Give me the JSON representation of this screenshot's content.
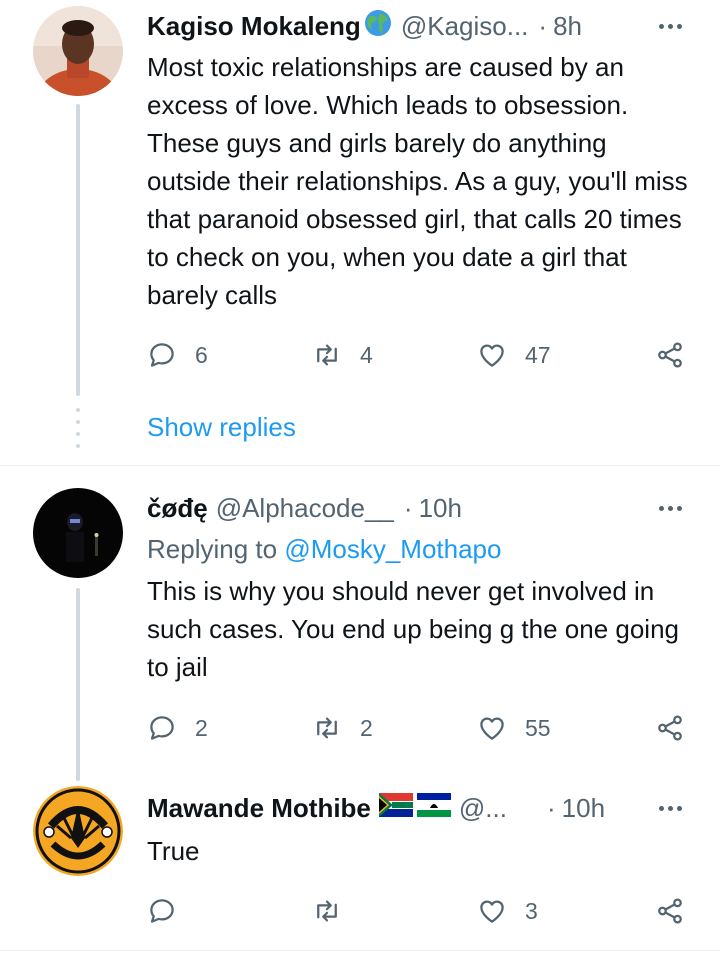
{
  "tweets": [
    {
      "name": "Kagiso Mokaleng",
      "handle": "@Kagiso...",
      "time": "8h",
      "text": "Most toxic relationships are caused by an excess of love. Which leads to obsession. These guys and girls barely do anything outside their relationships. As a guy, you'll miss that paranoid obsessed girl, that calls 20 times to check on you, when you date a girl that barely calls",
      "replies": "6",
      "retweets": "4",
      "likes": "47"
    },
    {
      "name": "čøđę",
      "handle": "@Alphacode__",
      "time": "10h",
      "replying_prefix": "Replying to",
      "replying_to": "@Mosky_Mothapo",
      "text": "This is why you should never get involved in such cases. You end up being g the one going to jail",
      "replies": "2",
      "retweets": "2",
      "likes": "55"
    },
    {
      "name": "Mawande Mothibe",
      "handle": "@...",
      "time": "10h",
      "text": "True",
      "replies": "",
      "retweets": "",
      "likes": "3"
    }
  ],
  "show_replies": "Show replies",
  "separator": "·",
  "icons": {
    "reply": "reply-icon",
    "retweet": "retweet-icon",
    "like": "like-icon",
    "share": "share-icon",
    "more": "more-icon"
  },
  "colors": {
    "link": "#1d9bf0",
    "muted": "#536471",
    "text": "#0f1419",
    "thread_line": "#cfd9de"
  }
}
